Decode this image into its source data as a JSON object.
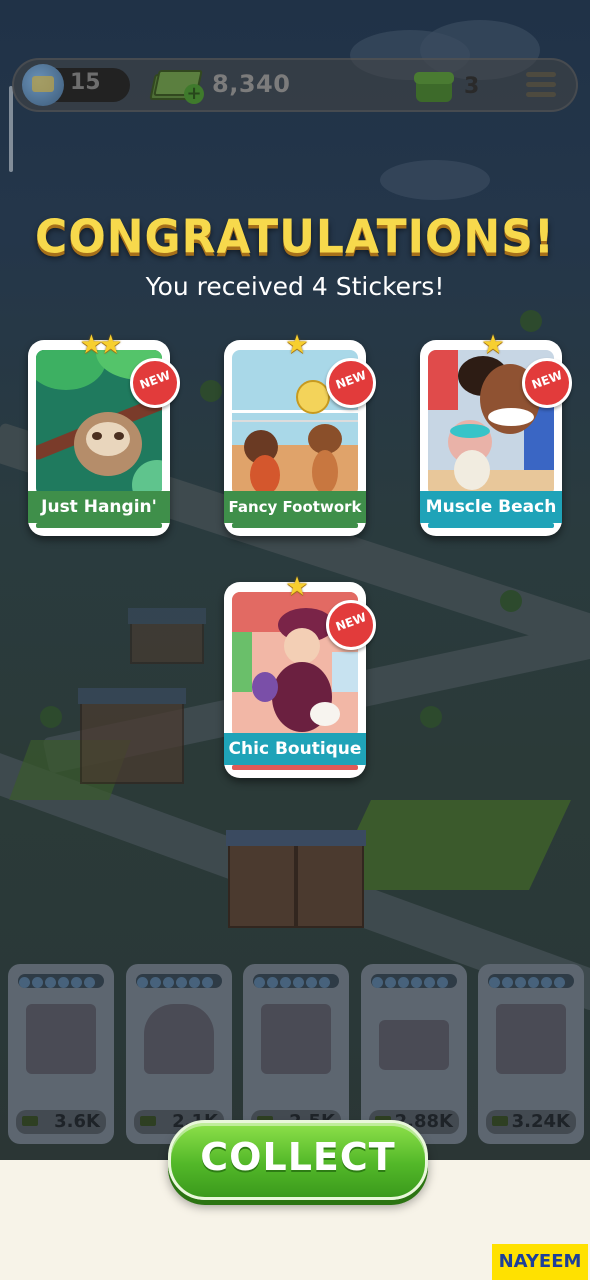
{
  "top_bar": {
    "level": "15",
    "cash": "8,340",
    "gifts": "3"
  },
  "dialog": {
    "title": "CONGRATULATIONS!",
    "subtitle": "You received 4 Stickers!",
    "new_badge": "NEW",
    "stickers": [
      {
        "name": "Just Hangin'",
        "stars": 2,
        "is_new": true,
        "label_color": "#3f8f4a"
      },
      {
        "name": "Fancy Footwork",
        "stars": 1,
        "is_new": true,
        "label_color": "#3f8f4a"
      },
      {
        "name": "Muscle Beach",
        "stars": 1,
        "is_new": true,
        "label_color": "#1fa3b8"
      },
      {
        "name": "Chic Boutique",
        "stars": 1,
        "is_new": true,
        "label_color": "#1fa3b8"
      }
    ],
    "collect_label": "COLLECT"
  },
  "properties": [
    {
      "price": "3.6K",
      "icon": "building-icon"
    },
    {
      "price": "2.1K",
      "icon": "water-tower-icon"
    },
    {
      "price": "2.5K",
      "icon": "station-icon"
    },
    {
      "price": "2.88K",
      "icon": "bridge-icon"
    },
    {
      "price": "3.24K",
      "icon": "castle-icon"
    }
  ],
  "watermark": "NAYEEM",
  "colors": {
    "title": "#f7d94c",
    "new_badge": "#e23b3b",
    "collect_button": "#53b829"
  }
}
